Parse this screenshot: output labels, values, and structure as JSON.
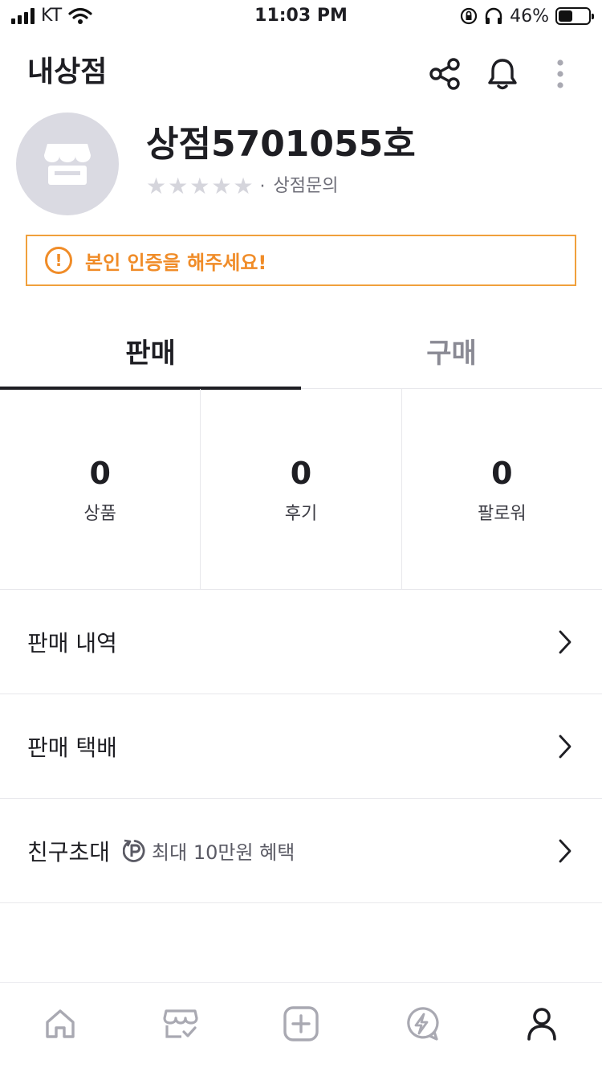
{
  "status_bar": {
    "carrier": "KT",
    "time": "11:03 PM",
    "battery_pct": "46%",
    "battery_level": 0.46
  },
  "header": {
    "title": "내상점",
    "icons": [
      "share-icon",
      "bell-icon",
      "more-vertical-icon"
    ]
  },
  "profile": {
    "shop_name": "상점5701055호",
    "rating_stars": 5,
    "rating_filled": 0,
    "separator": "·",
    "inquiry_label": "상점문의"
  },
  "alert": {
    "icon_text": "!",
    "text": "본인 인증을 해주세요!",
    "color": "#f08c28"
  },
  "tabs": [
    {
      "label": "판매",
      "active": true
    },
    {
      "label": "구매",
      "active": false
    }
  ],
  "stats": [
    {
      "value": "0",
      "label": "상품"
    },
    {
      "value": "0",
      "label": "후기"
    },
    {
      "value": "0",
      "label": "팔로워"
    }
  ],
  "menu": [
    {
      "label": "판매 내역"
    },
    {
      "label": "판매 택배"
    },
    {
      "label": "친구초대",
      "benefit": "최대 10만원 혜택",
      "benefit_icon": "point-badge-icon"
    }
  ],
  "bottom_nav": [
    {
      "icon": "home-icon"
    },
    {
      "icon": "store-check-icon"
    },
    {
      "icon": "add-square-icon"
    },
    {
      "icon": "lightning-chat-icon"
    },
    {
      "icon": "person-icon",
      "active": true
    }
  ],
  "colors": {
    "text_primary": "#1e1e23",
    "muted": "#8a8a94",
    "accent_warning": "#f08c28",
    "avatar_bg": "#dadae2"
  }
}
